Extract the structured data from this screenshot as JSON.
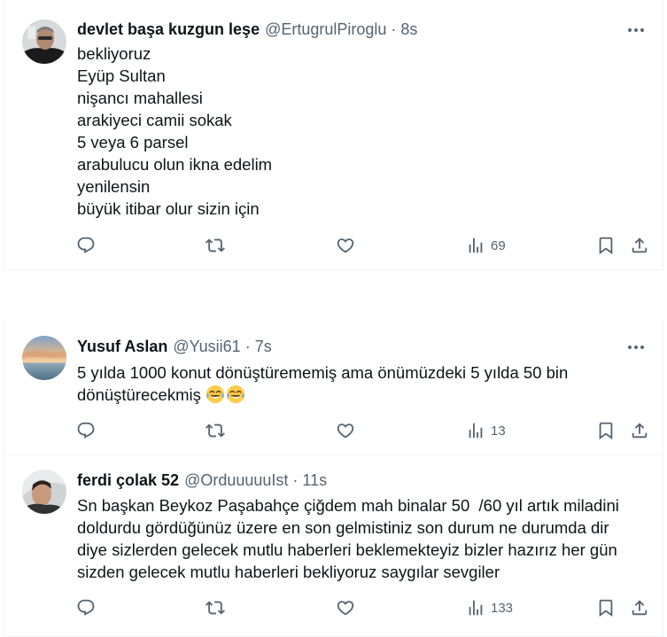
{
  "colors": {
    "text": "#0f1419",
    "muted": "#536471",
    "border": "#eff3f4"
  },
  "icons": {
    "more": "more-horizontal-icon",
    "reply": "reply-icon",
    "repost": "repost-icon",
    "like": "like-icon",
    "views": "views-icon",
    "bookmark": "bookmark-icon",
    "share": "share-icon",
    "laugh": "face-with-tears-of-joy-emoji"
  },
  "tweets": [
    {
      "name": "devlet başa kuzgun leşe",
      "handle": "@ErtugrulPiroglu",
      "dot": "·",
      "time": "8s",
      "lines": [
        "bekliyoruz",
        "Eyüp Sultan",
        "nişancı mahallesi",
        "arakiyeci camii sokak",
        "5 veya 6 parsel",
        "arabulucu olun ikna edelim",
        "yenilensin",
        "büyük itibar olur sizin için"
      ],
      "views": "69"
    },
    {
      "name": "Yusuf Aslan",
      "handle": "@Yusii61",
      "dot": "·",
      "time": "7s",
      "lines": [
        "5 yılda 1000 konut dönüştürememiş ama önümüzdeki 5 yılda 50 bin",
        "dönüştürecekmiş"
      ],
      "views": "13"
    },
    {
      "name": "ferdi çolak 52",
      "handle": "@OrduuuuuIst",
      "dot": "·",
      "time": "11s",
      "lines": [
        "Sn başkan Beykoz Paşabahçe çiğdem mah binalar 50  /60 yıl artık miladini",
        "doldurdu gördüğünüz üzere en son gelmistiniz son durum ne durumda dir",
        "diye sizlerden gelecek mutlu haberleri beklemekteyiz bizler hazırız her gün",
        "sizden gelecek mutlu haberleri bekliyoruz saygılar sevgiler"
      ],
      "views": "133"
    }
  ]
}
